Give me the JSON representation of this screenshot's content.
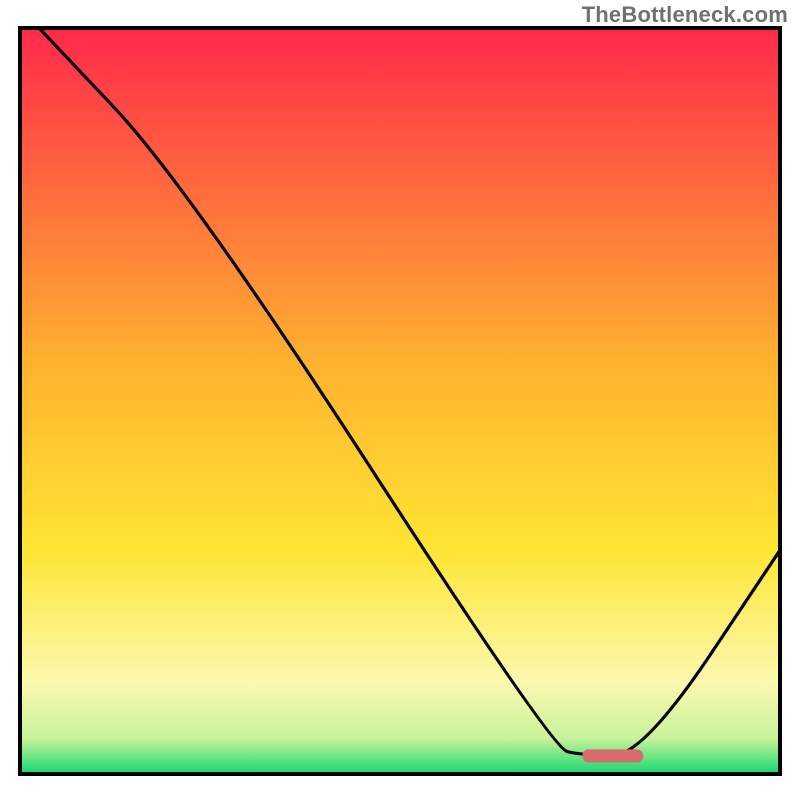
{
  "watermark": "TheBottleneck.com",
  "chart_data": {
    "type": "line",
    "title": "",
    "xlabel": "",
    "ylabel": "",
    "xlim": [
      0,
      100
    ],
    "ylim": [
      0,
      100
    ],
    "series": [
      {
        "name": "bottleneck-curve",
        "points": [
          {
            "x": 2.5,
            "y": 100
          },
          {
            "x": 22,
            "y": 79
          },
          {
            "x": 70,
            "y": 3.5
          },
          {
            "x": 74,
            "y": 2.5
          },
          {
            "x": 82,
            "y": 2.5
          },
          {
            "x": 100,
            "y": 30
          }
        ]
      }
    ],
    "marker": {
      "x_start": 74,
      "x_end": 82,
      "y": 2.5,
      "color": "#d86b6b"
    },
    "background_gradient": {
      "stops": [
        {
          "offset": 0.0,
          "color": "#ff2a4b"
        },
        {
          "offset": 0.45,
          "color": "#ffb22f"
        },
        {
          "offset": 0.7,
          "color": "#ffe533"
        },
        {
          "offset": 0.88,
          "color": "#fbf9b0"
        },
        {
          "offset": 0.955,
          "color": "#c8f29a"
        },
        {
          "offset": 1.0,
          "color": "#1fd973"
        }
      ]
    },
    "frame_color": "#000000"
  }
}
